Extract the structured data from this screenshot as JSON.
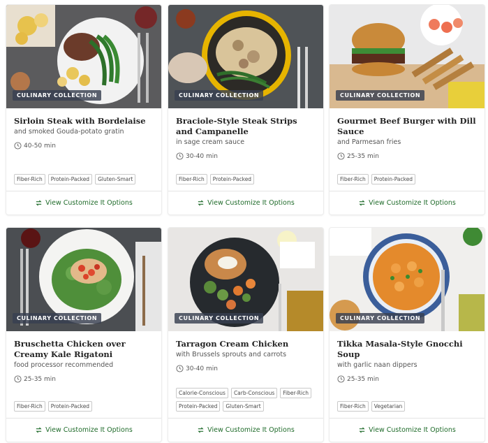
{
  "badge_label": "CULINARY COLLECTION",
  "footer_label": "View Customize It Options",
  "colors": {
    "accent_green": "#1f6b2a",
    "badge_bg": "#384050"
  },
  "cards": [
    {
      "title": "Sirloin Steak with Bordelaise",
      "subtitle": "and smoked Gouda-potato gratin",
      "time": "40-50 min",
      "tags": [
        "Fiber-Rich",
        "Protein-Packed",
        "Gluten-Smart"
      ]
    },
    {
      "title": "Braciole-Style Steak Strips and Campanelle",
      "subtitle": "in sage cream sauce",
      "time": "30-40 min",
      "tags": [
        "Fiber-Rich",
        "Protein-Packed"
      ]
    },
    {
      "title": "Gourmet Beef Burger with Dill Sauce",
      "subtitle": "and Parmesan fries",
      "time": "25-35 min",
      "tags": [
        "Fiber-Rich",
        "Protein-Packed"
      ]
    },
    {
      "title": "Bruschetta Chicken over Creamy Kale Rigatoni",
      "subtitle": "food processor recommended",
      "time": "25-35 min",
      "tags": [
        "Fiber-Rich",
        "Protein-Packed"
      ]
    },
    {
      "title": "Tarragon Cream Chicken",
      "subtitle": "with Brussels sprouts and carrots",
      "time": "30-40 min",
      "tags": [
        "Calorie-Conscious",
        "Carb-Conscious",
        "Fiber-Rich",
        "Protein-Packed",
        "Gluten-Smart"
      ]
    },
    {
      "title": "Tikka Masala-Style Gnocchi Soup",
      "subtitle": "with garlic naan dippers",
      "time": "25-35 min",
      "tags": [
        "Fiber-Rich",
        "Vegetarian"
      ]
    }
  ]
}
